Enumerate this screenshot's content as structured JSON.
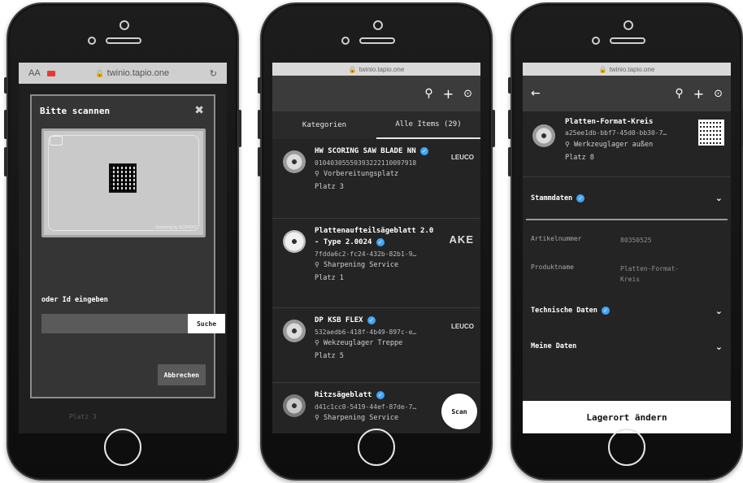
{
  "phone1": {
    "browser": {
      "aa": "AA",
      "url": "twinio.tapio.one"
    },
    "modal": {
      "title": "Bitte scannen",
      "close": "✖",
      "camera_caption": "Scanning by SCANDIT",
      "manual_label": "oder Id eingeben",
      "input_value": "",
      "search_button": "Suche",
      "cancel_button": "Abbrechen"
    },
    "behind_text": "Platz 3"
  },
  "phone2": {
    "browser": {
      "url": "twinio.tapio.one"
    },
    "tabs": [
      "Kategorien",
      "Alle Items (29)"
    ],
    "items": [
      {
        "name": "HW SCORING SAW BLADE NN",
        "id": "01040305559393222110097918",
        "location": "Vorbereitungsplatz",
        "place": "Platz 3",
        "brand": "LEUCO"
      },
      {
        "name": "Plattenaufteilsägeblatt 2.0 - Type 2.0024",
        "id": "7fdda6c2-fc24-432b-82b1-9…",
        "location": "Sharpening Service",
        "place": "Platz 1",
        "brand": "AKE"
      },
      {
        "name": "DP KSB FLEX",
        "id": "532aedb6-418f-4b49-897c-e…",
        "location": "Wekzeuglager Treppe",
        "place": "Platz 5",
        "brand": "LEUCO"
      },
      {
        "name": "Ritzsägeblatt",
        "id": "d41c1cc0-5419-44ef-87de-7…",
        "location": "Sharpening Service",
        "place": "",
        "brand": ""
      }
    ],
    "scan_button": "Scan"
  },
  "phone3": {
    "browser": {
      "url": "twinio.tapio.one"
    },
    "item": {
      "name": "Platten-Format-Kreis",
      "id": "a25ee1db-bbf7-45d0-bb30-7…",
      "location": "Werkzeuglager außen",
      "place": "Platz 8"
    },
    "sections": {
      "stammdaten": "Stammdaten",
      "technische": "Technische Daten",
      "meine": "Meine Daten"
    },
    "fields": [
      {
        "key": "Artikelnummer",
        "value": "80350525"
      },
      {
        "key": "Produktname",
        "value": "Platten-Format-Kreis"
      }
    ],
    "action_button": "Lagerort ändern"
  }
}
